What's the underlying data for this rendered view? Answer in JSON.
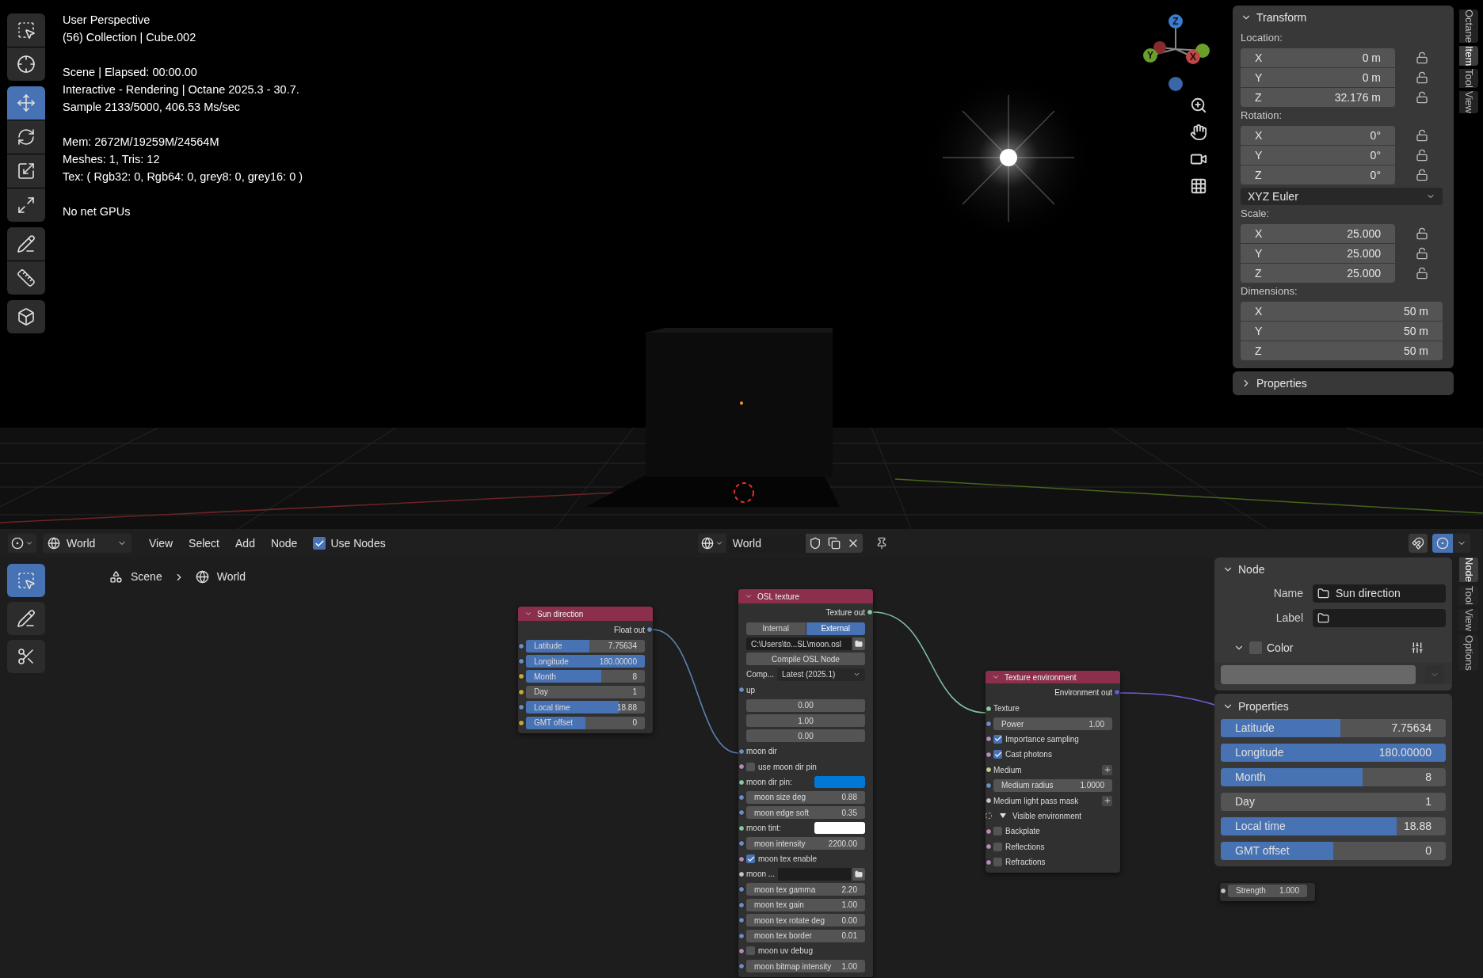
{
  "viewport": {
    "tools": [
      {
        "kind": "select_box",
        "selected": false
      },
      {
        "kind": "cursor",
        "selected": false
      },
      {
        "kind": "move",
        "selected": true
      },
      {
        "kind": "rotate",
        "selected": false
      },
      {
        "kind": "scale",
        "selected": false
      },
      {
        "kind": "transform",
        "selected": false
      },
      {
        "kind": "annotate",
        "selected": false
      },
      {
        "kind": "measure",
        "selected": false
      },
      {
        "kind": "add_cube",
        "selected": false
      }
    ],
    "info_groups": [
      [
        "User Perspective",
        "(56) Collection | Cube.002"
      ],
      [
        "Scene | Elapsed: 00:00.00",
        "Interactive - Rendering | Octane 2025.3 - 30.7.",
        "Sample 2133/5000, 406.53 Ms/sec"
      ],
      [
        "Mem: 2672M/19259M/24564M",
        "Meshes: 1, Tris: 12",
        "Tex: ( Rgb32: 0, Rgb64: 0, grey8: 0, grey16: 0 )"
      ],
      [
        "No net GPUs"
      ]
    ],
    "gizmo_axes": [
      "Z",
      "Y",
      "X"
    ],
    "sidebar": {
      "panels": [
        {
          "title": "Transform",
          "expanded": true,
          "groups": [
            {
              "label": "Location:",
              "lockable": true,
              "rows": [
                {
                  "axis": "X",
                  "value": "0 m"
                },
                {
                  "axis": "Y",
                  "value": "0 m"
                },
                {
                  "axis": "Z",
                  "value": "32.176 m"
                }
              ]
            },
            {
              "label": "Rotation:",
              "lockable": true,
              "rows": [
                {
                  "axis": "X",
                  "value": "0°"
                },
                {
                  "axis": "Y",
                  "value": "0°"
                },
                {
                  "axis": "Z",
                  "value": "0°"
                }
              ],
              "dropdown": "XYZ Euler"
            },
            {
              "label": "Scale:",
              "lockable": true,
              "rows": [
                {
                  "axis": "X",
                  "value": "25.000"
                },
                {
                  "axis": "Y",
                  "value": "25.000"
                },
                {
                  "axis": "Z",
                  "value": "25.000"
                }
              ]
            },
            {
              "label": "Dimensions:",
              "lockable": false,
              "rows": [
                {
                  "axis": "X",
                  "value": "50 m"
                },
                {
                  "axis": "Y",
                  "value": "50 m"
                },
                {
                  "axis": "Z",
                  "value": "50 m"
                }
              ]
            }
          ]
        },
        {
          "title": "Properties",
          "expanded": false
        }
      ],
      "tabs": [
        {
          "label": "Octane",
          "selected": false
        },
        {
          "label": "Item",
          "selected": true
        },
        {
          "label": "Tool",
          "selected": false
        },
        {
          "label": "View",
          "selected": false
        }
      ]
    }
  },
  "node_editor": {
    "header": {
      "world": "World",
      "menus": [
        "View",
        "Select",
        "Add",
        "Node"
      ],
      "use_nodes": {
        "label": "Use Nodes",
        "checked": true
      },
      "datablock": "World"
    },
    "tools": [
      {
        "kind": "select_box",
        "selected": true
      },
      {
        "kind": "annotate",
        "selected": false
      },
      {
        "kind": "cut",
        "selected": false
      }
    ],
    "breadcrumb": [
      "Scene",
      "World"
    ],
    "nodes": [
      {
        "title": "Sun direction",
        "expanded": true,
        "rows": [
          {
            "kind": "output",
            "label": "Float out",
            "color": "#6c8ebf"
          },
          {
            "kind": "slider",
            "label": "Latitude",
            "value": "7.75634",
            "level": 0.53,
            "color": "#6c8ebf"
          },
          {
            "kind": "slider",
            "label": "Longitude",
            "value": "180.00000",
            "level": 1,
            "color": "#6c8ebf"
          },
          {
            "kind": "slider",
            "label": "Month",
            "value": "8",
            "level": 0.63,
            "color": "#c7a83a"
          },
          {
            "kind": "slider",
            "label": "Day",
            "value": "1",
            "color": "#c7a83a"
          },
          {
            "kind": "slider",
            "label": "Local time",
            "value": "18.88",
            "level": 0.78,
            "color": "#6c8ebf"
          },
          {
            "kind": "slider",
            "label": "GMT offset",
            "value": "0",
            "level": 0.5,
            "color": "#c7a83a"
          }
        ]
      },
      {
        "title": "OSL texture",
        "expanded": true,
        "rows": [
          {
            "kind": "output",
            "label": "Texture out",
            "color": "#8cc7a0"
          },
          {
            "kind": "toggle",
            "options": [
              {
                "label": "Internal",
                "selected": false
              },
              {
                "label": "External",
                "selected": true
              }
            ]
          },
          {
            "kind": "file",
            "value": "C:\\Users\\to...SL\\moon.osl"
          },
          {
            "kind": "button",
            "label": "Compile OSL Node"
          },
          {
            "kind": "select",
            "label": "Comp...",
            "value": "Latest (2025.1)"
          },
          {
            "kind": "socket",
            "label": "up",
            "color": "#6c8ebf"
          },
          {
            "kind": "number",
            "value": "0.00"
          },
          {
            "kind": "number",
            "value": "1.00"
          },
          {
            "kind": "number",
            "value": "0.00"
          },
          {
            "kind": "socket",
            "label": "moon dir",
            "color": "#6c8ebf"
          },
          {
            "kind": "checkbox",
            "label": "use moon dir pin",
            "checked": false,
            "color": "#b58bb2"
          },
          {
            "kind": "swatch",
            "label": "moon dir pin:",
            "color": "#0078d7",
            "socket": {
              "color": "#8cc7a0"
            }
          },
          {
            "kind": "number",
            "label": "moon size deg",
            "value": "0.88",
            "color": "#6c8ebf"
          },
          {
            "kind": "number",
            "label": "moon edge soft",
            "value": "0.35",
            "color": "#6c8ebf"
          },
          {
            "kind": "swatch",
            "label": "moon tint:",
            "color": "#ffffff",
            "socket": {
              "color": "#8cc7a0"
            }
          },
          {
            "kind": "number",
            "label": "moon intensity",
            "value": "2200.00",
            "color": "#6c8ebf"
          },
          {
            "kind": "checkbox",
            "label": "moon tex enable",
            "checked": true,
            "color": "#b58bb2"
          },
          {
            "kind": "file_input",
            "label": "moon ...",
            "color": "#c4c4c4"
          },
          {
            "kind": "number",
            "label": "moon tex gamma",
            "value": "2.20",
            "color": "#6c8ebf"
          },
          {
            "kind": "number",
            "label": "moon tex gain",
            "value": "1.00",
            "color": "#6c8ebf"
          },
          {
            "kind": "number",
            "label": "moon tex rotate deg",
            "value": "0.00",
            "color": "#6c8ebf"
          },
          {
            "kind": "number",
            "label": "moon tex border",
            "value": "0.01",
            "color": "#6c8ebf"
          },
          {
            "kind": "checkbox",
            "label": "moon uv debug",
            "checked": false,
            "color": "#b58bb2"
          },
          {
            "kind": "number",
            "label": "moon bitmap intensity",
            "value": "1.00",
            "color": "#6c8ebf"
          }
        ]
      },
      {
        "title": "Texture environment",
        "expanded": true,
        "rows": [
          {
            "kind": "output",
            "label": "Environment out",
            "color": "#6363c7"
          },
          {
            "kind": "socket",
            "label": "Texture",
            "color": "#8cc7a0"
          },
          {
            "kind": "number",
            "label": "Power",
            "value": "1.00",
            "color": "#6c8ebf"
          },
          {
            "kind": "checkbox",
            "label": "Importance sampling",
            "checked": true,
            "color": "#b58bb2"
          },
          {
            "kind": "checkbox",
            "label": "Cast photons",
            "checked": true,
            "color": "#b58bb2"
          },
          {
            "kind": "add",
            "label": "Medium",
            "color": "#c9c59a"
          },
          {
            "kind": "number",
            "label": "Medium radius",
            "value": "1.0000",
            "color": "#6c8ebf"
          },
          {
            "kind": "add",
            "label": "Medium light pass mask",
            "color": "#c4c4c4"
          },
          {
            "kind": "panel",
            "label": "Visible environment",
            "expanded": true
          },
          {
            "kind": "checkbox",
            "label": "Backplate",
            "checked": false,
            "color": "#b58bb2"
          },
          {
            "kind": "checkbox",
            "label": "Reflections",
            "checked": false,
            "color": "#b58bb2"
          },
          {
            "kind": "checkbox",
            "label": "Refractions",
            "checked": false,
            "color": "#b58bb2"
          }
        ]
      },
      {
        "rows": [
          {
            "kind": "number",
            "label": "Strength",
            "value": "1.000",
            "color": "#c4c4c4"
          }
        ]
      }
    ],
    "sidebar": {
      "node_panel": {
        "title": "Node",
        "expanded": true,
        "name": {
          "label": "Name",
          "value": "Sun direction"
        },
        "label": {
          "label": "Label"
        },
        "color": {
          "label": "Color",
          "expanded": true,
          "checked": false,
          "color": "#686868"
        }
      },
      "properties": {
        "title": "Properties",
        "expanded": true,
        "fields": [
          {
            "label": "Latitude",
            "value": "7.75634",
            "level": 0.53
          },
          {
            "label": "Longitude",
            "value": "180.00000",
            "level": 1
          },
          {
            "label": "Month",
            "value": "8",
            "level": 0.63
          },
          {
            "label": "Day",
            "value": "1"
          },
          {
            "label": "Local time",
            "value": "18.88",
            "level": 0.78
          },
          {
            "label": "GMT offset",
            "value": "0",
            "level": 0.5
          }
        ]
      },
      "tabs": [
        {
          "label": "Node",
          "selected": true
        },
        {
          "label": "Tool",
          "selected": false
        },
        {
          "label": "View",
          "selected": false
        },
        {
          "label": "Options",
          "selected": false
        }
      ]
    }
  }
}
